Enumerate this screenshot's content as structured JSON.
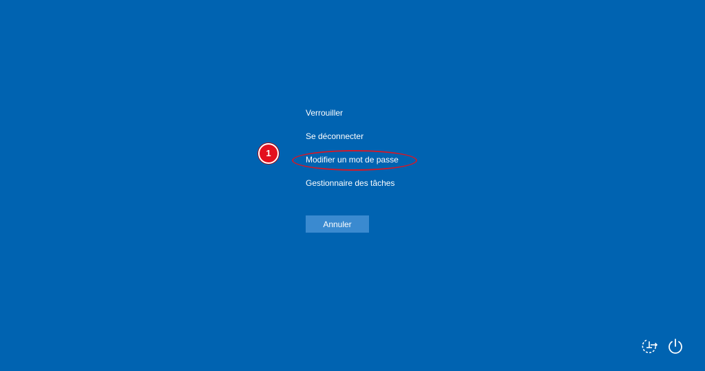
{
  "security_options": {
    "items": [
      {
        "label": "Verrouiller"
      },
      {
        "label": "Se déconnecter"
      },
      {
        "label": "Modifier un mot de passe"
      },
      {
        "label": "Gestionnaire des tâches"
      }
    ],
    "cancel_label": "Annuler"
  },
  "annotation": {
    "step_number": "1",
    "color": "#e3101e"
  },
  "bottom_icons": [
    {
      "icon": "network-icon"
    },
    {
      "icon": "power-icon"
    }
  ],
  "colors": {
    "background": "#0063b1",
    "button": "#3a8ad0",
    "text": "#ffffff"
  }
}
